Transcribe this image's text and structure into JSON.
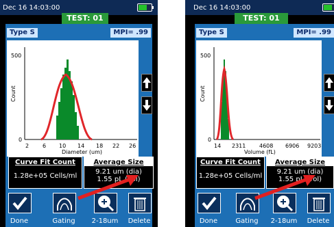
{
  "screens": [
    {
      "datetime": "Dec 16  14:03:00",
      "test": "TEST: 01",
      "type": "Type S",
      "mpi": "MPI= .99",
      "y_axis_label": "Count",
      "x_axis_label": "Diameter (um)",
      "y_ticks": [
        "500",
        "0"
      ],
      "x_ticks": [
        "2",
        "6",
        "10",
        "14",
        "18",
        "22",
        "26"
      ],
      "curve_fit_title": "Curve Fit Count",
      "curve_fit_value": "1.28e+05 Cells/ml",
      "avg_title": "Average Size",
      "avg_line1": "9.21 um (dia)",
      "avg_line2": "1.55 pL (vol)"
    },
    {
      "datetime": "Dec 16  14:03:00",
      "test": "TEST: 01",
      "type": "Type S",
      "mpi": "MPI= .99",
      "y_axis_label": "Count",
      "x_axis_label": "Volume (fL)",
      "y_ticks": [
        "500",
        "0"
      ],
      "x_ticks": [
        "14",
        "2311",
        "4608",
        "6906",
        "9203"
      ],
      "curve_fit_title": "Curve Fit Count",
      "curve_fit_value": "1.28e+05 Cells/ml",
      "avg_title": "Average Size",
      "avg_line1": "9.21 um (dia)",
      "avg_line2": "1.55 pL (vol)"
    }
  ],
  "toolbar": {
    "done": "Done",
    "gating": "Gating",
    "range": "2-18um",
    "delete": "Delete"
  },
  "colors": {
    "panel": "#1d6fb5",
    "test_green": "#2a9a3a",
    "curve": "#e0262a",
    "bars": "#0a8a2a",
    "arrow": "#e22020"
  }
}
